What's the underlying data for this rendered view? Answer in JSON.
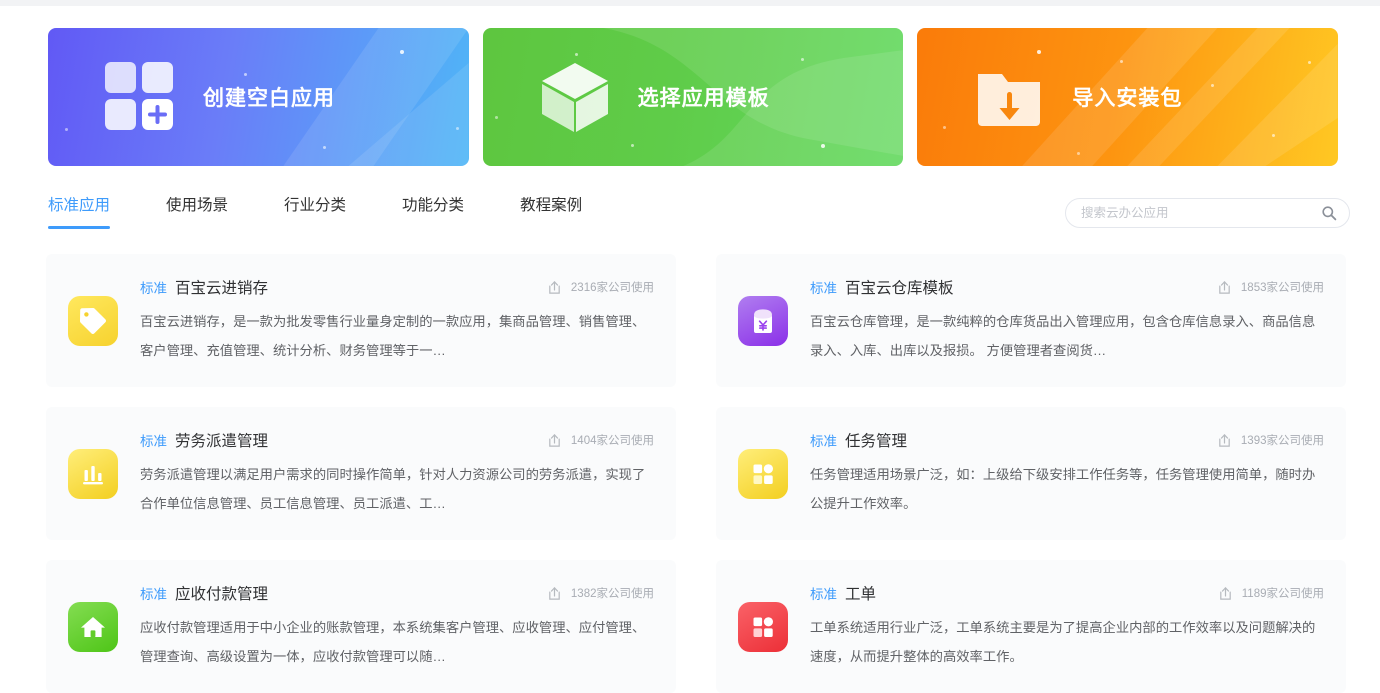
{
  "banners": [
    {
      "label": "创建空白应用",
      "icon": "grid-plus-icon",
      "color": "#6159f5",
      "theme": "b-blue"
    },
    {
      "label": "选择应用模板",
      "icon": "cube-icon",
      "color": "#5ec63f",
      "theme": "b-green"
    },
    {
      "label": "导入安装包",
      "icon": "folder-download-icon",
      "color": "#fa7b0a",
      "theme": "b-orange"
    }
  ],
  "tabs": [
    {
      "label": "标准应用",
      "active": true
    },
    {
      "label": "使用场景",
      "active": false
    },
    {
      "label": "行业分类",
      "active": false
    },
    {
      "label": "功能分类",
      "active": false
    },
    {
      "label": "教程案例",
      "active": false
    }
  ],
  "search": {
    "placeholder": "搜索云办公应用",
    "value": "",
    "icon": "search-icon"
  },
  "accent_color": "#3e9bfb",
  "cards": [
    {
      "badge": "标准",
      "title": "百宝云进销存",
      "usage": "2316家公司使用",
      "usage_icon": "upload-share-icon",
      "desc": "百宝云进销存，是一款为批发零售行业量身定制的一款应用，集商品管理、销售管理、客户管理、充值管理、统计分析、财务管理等于一…",
      "icon": "price-tag-icon",
      "icon_color_from": "#ffe142",
      "icon_color_to": "#f8d535"
    },
    {
      "badge": "标准",
      "title": "百宝云仓库模板",
      "usage": "1853家公司使用",
      "usage_icon": "upload-share-icon",
      "desc": "百宝云仓库管理，是一款纯粹的仓库货品出入管理应用，包含仓库信息录入、商品信息录入、入库、出库以及报损。 方便管理者查阅货…",
      "icon": "red-envelope-yuan-icon",
      "icon_color_from": "#b07ef0",
      "icon_color_to": "#8b2fe8"
    },
    {
      "badge": "标准",
      "title": "劳务派遣管理",
      "usage": "1404家公司使用",
      "usage_icon": "upload-share-icon",
      "desc": "劳务派遣管理以满足用户需求的同时操作简单，针对人力资源公司的劳务派遣，实现了合作单位信息管理、员工信息管理、员工派遣、工…",
      "icon": "bar-chart-icon",
      "icon_color_from": "#ffe968",
      "icon_color_to": "#f5d11f"
    },
    {
      "badge": "标准",
      "title": "任务管理",
      "usage": "1393家公司使用",
      "usage_icon": "upload-share-icon",
      "desc": "任务管理适用场景广泛，如：上级给下级安排工作任务等，任务管理使用简单，随时办公提升工作效率。",
      "icon": "task-blocks-icon",
      "icon_color_from": "#ffe968",
      "icon_color_to": "#f5d11f"
    },
    {
      "badge": "标准",
      "title": "应收付款管理",
      "usage": "1382家公司使用",
      "usage_icon": "upload-share-icon",
      "desc": "应收付款管理适用于中小企业的账款管理，本系统集客户管理、应收管理、应付管理、管理查询、高级设置为一体，应收付款管理可以随…",
      "icon": "home-icon",
      "icon_color_from": "#7fd64a",
      "icon_color_to": "#52c41a"
    },
    {
      "badge": "标准",
      "title": "工单",
      "usage": "1189家公司使用",
      "usage_icon": "upload-share-icon",
      "desc": "工单系统适用行业广泛，工单系统主要是为了提高企业内部的工作效率以及问题解决的速度，从而提升整体的高效率工作。",
      "icon": "task-blocks-icon",
      "icon_color_from": "#f8545a",
      "icon_color_to": "#ef3a41"
    }
  ]
}
